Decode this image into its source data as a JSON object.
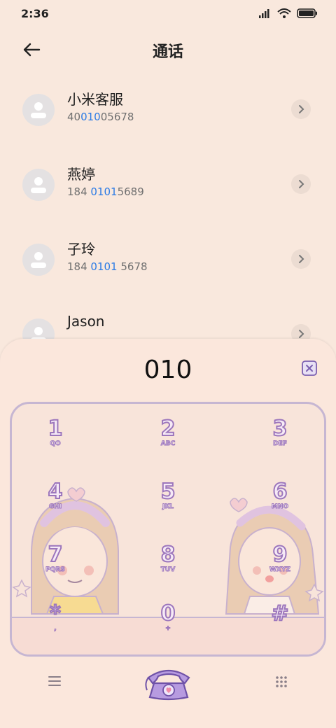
{
  "status": {
    "time": "2:36"
  },
  "header": {
    "title": "通话"
  },
  "contacts": [
    {
      "name": "小米客服",
      "number": {
        "pre": "40",
        "hl": "010",
        "post": "05678"
      }
    },
    {
      "name": "燕婷",
      "number": {
        "pre": "184 ",
        "hl": "0101",
        "post": "5689"
      }
    },
    {
      "name": "子玲",
      "number": {
        "pre": "184 ",
        "hl": "0101",
        "post": " 5678"
      }
    },
    {
      "name": "Jason"
    }
  ],
  "dialer": {
    "number": "010",
    "keys": [
      {
        "digit": "1",
        "letters": "QO"
      },
      {
        "digit": "2",
        "letters": "ABC"
      },
      {
        "digit": "3",
        "letters": "DEF"
      },
      {
        "digit": "4",
        "letters": "GHI"
      },
      {
        "digit": "5",
        "letters": "JKL"
      },
      {
        "digit": "6",
        "letters": "MNO"
      },
      {
        "digit": "7",
        "letters": "PQRS"
      },
      {
        "digit": "8",
        "letters": "TUV"
      },
      {
        "digit": "9",
        "letters": "WXYZ"
      },
      {
        "digit": "*",
        "letters": ","
      },
      {
        "digit": "0",
        "letters": "+"
      },
      {
        "digit": "#",
        "letters": ""
      }
    ]
  },
  "icons": {
    "back": "arrow-left-icon",
    "delete": "backspace-icon",
    "menu": "menu-icon",
    "call": "telephone-icon",
    "keypad": "keypad-icon"
  },
  "colors": {
    "accent": "#2c7be5",
    "keypad_outline": "#9c76bc",
    "background": "#f9e8dd"
  }
}
